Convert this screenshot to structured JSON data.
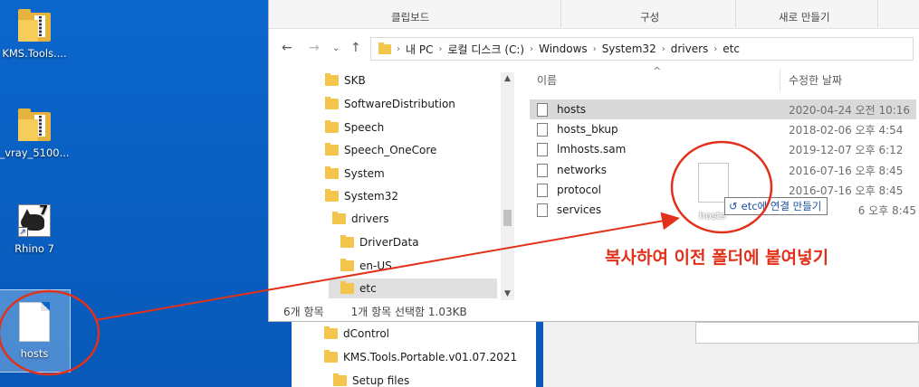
{
  "desktop": {
    "icons": [
      {
        "label": "KMS.Tools....",
        "type": "zip-folder"
      },
      {
        "label": "_vray_5100...",
        "type": "zip-folder"
      },
      {
        "label": "Rhino 7",
        "type": "app-shortcut",
        "badge": "7"
      },
      {
        "label": "hosts",
        "type": "file",
        "selected": true
      }
    ]
  },
  "ribbon": {
    "groups": [
      "클립보드",
      "구성",
      "새로 만들기"
    ]
  },
  "address": {
    "crumbs": [
      "내 PC",
      "로컬 디스크 (C:)",
      "Windows",
      "System32",
      "drivers",
      "etc"
    ]
  },
  "nav_tree": [
    {
      "label": "SKB"
    },
    {
      "label": "SoftwareDistribution"
    },
    {
      "label": "Speech"
    },
    {
      "label": "Speech_OneCore"
    },
    {
      "label": "System"
    },
    {
      "label": "System32"
    },
    {
      "label": "drivers"
    },
    {
      "label": "DriverData"
    },
    {
      "label": "en-US"
    },
    {
      "label": "etc",
      "selected": true
    }
  ],
  "lower_tree": [
    {
      "label": "dControl"
    },
    {
      "label": "KMS.Tools.Portable.v01.07.2021"
    },
    {
      "label": "Setup files"
    }
  ],
  "file_list": {
    "columns": {
      "name": "이름",
      "date": "수정한 날짜"
    },
    "rows": [
      {
        "name": "hosts",
        "date": "2020-04-24 오전 10:16",
        "selected": true
      },
      {
        "name": "hosts_bkup",
        "date": "2018-02-06 오후 4:54"
      },
      {
        "name": "lmhosts.sam",
        "date": "2019-12-07 오후 6:12"
      },
      {
        "name": "networks",
        "date": "2016-07-16 오후 8:45"
      },
      {
        "name": "protocol",
        "date": "2016-07-16 오후 8:45"
      },
      {
        "name": "services",
        "date": "6 오후 8:45"
      }
    ]
  },
  "status": {
    "count": "6개 항목",
    "selection": "1개 항목 선택함 1.03KB"
  },
  "drag": {
    "ghost_label": "hosts",
    "tooltip_text": "etc에 연결 만들기",
    "tooltip_icon": "↺"
  },
  "annotation": {
    "text": "복사하여 이전 폴더에 붙여넣기",
    "color": "#e2311a"
  }
}
